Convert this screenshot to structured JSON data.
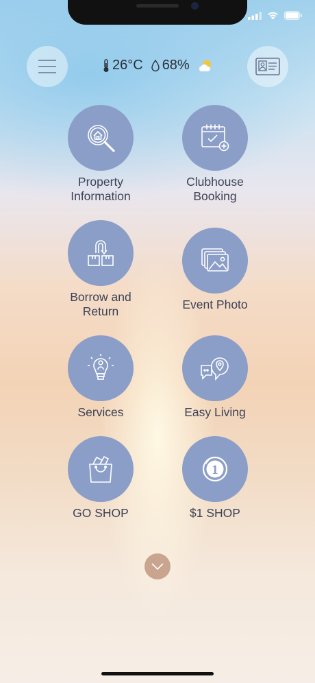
{
  "weather": {
    "temperature": "26°C",
    "humidity": "68%",
    "condition_icon": "sun-cloud-icon"
  },
  "header": {
    "menu_icon": "hamburger-menu-icon",
    "profile_icon": "id-card-icon"
  },
  "tiles": [
    {
      "label": "Property Information",
      "icon": "house-search-icon"
    },
    {
      "label": "Clubhouse Booking",
      "icon": "calendar-booking-icon"
    },
    {
      "label": "Borrow and Return",
      "icon": "boxes-return-icon"
    },
    {
      "label": "Event Photo",
      "icon": "photo-gallery-icon"
    },
    {
      "label": "Services",
      "icon": "lightbulb-person-icon"
    },
    {
      "label": "Easy Living",
      "icon": "chat-location-icon"
    },
    {
      "label": "GO SHOP",
      "icon": "shopping-bag-icon"
    },
    {
      "label": "$1 SHOP",
      "icon": "coin-one-icon"
    }
  ],
  "colors": {
    "tile": "#8b9ec8",
    "scroll_button": "#c9a48e",
    "label_text": "#3c4256"
  }
}
